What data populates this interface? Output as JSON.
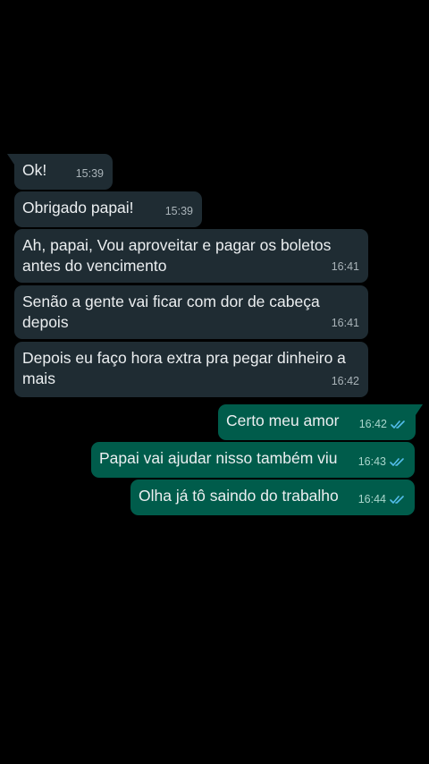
{
  "colors": {
    "background": "#000000",
    "incoming_bubble": "#1f2c33",
    "outgoing_bubble": "#005c4b",
    "read_ticks": "#53bdeb"
  },
  "messages": [
    {
      "direction": "in",
      "text": "Ok!",
      "time": "15:39"
    },
    {
      "direction": "in",
      "text": "Obrigado papai!",
      "time": "15:39"
    },
    {
      "direction": "in",
      "text": "Ah, papai, Vou aproveitar e pagar os boletos\nantes do vencimento",
      "time": "16:41"
    },
    {
      "direction": "in",
      "text": "Senão a gente vai ficar com dor de cabeça\ndepois",
      "time": "16:41"
    },
    {
      "direction": "in",
      "text": "Depois eu faço hora extra pra pegar dinheiro a\nmais",
      "time": "16:42"
    },
    {
      "direction": "out",
      "text": "Certo meu amor",
      "time": "16:42",
      "status_icon": "double-check-read-icon"
    },
    {
      "direction": "out",
      "text": "Papai vai ajudar nisso também viu",
      "time": "16:43",
      "status_icon": "double-check-read-icon"
    },
    {
      "direction": "out",
      "text": "Olha já tô saindo do trabalho",
      "time": "16:44",
      "status_icon": "double-check-read-icon"
    }
  ]
}
